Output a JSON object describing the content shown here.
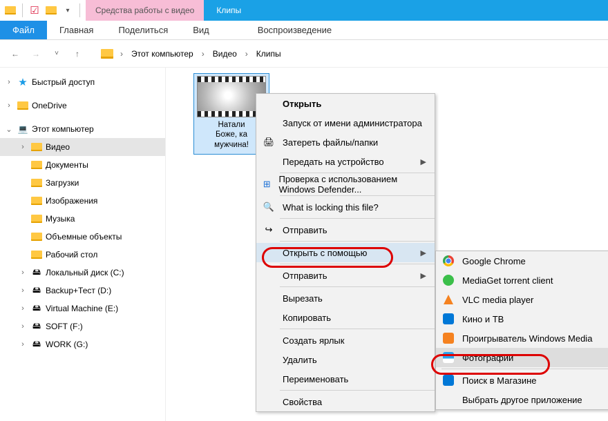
{
  "title_context_tab": "Средства работы с видео",
  "window_title": "Клипы",
  "ribbon": {
    "file": "Файл",
    "home": "Главная",
    "share": "Поделиться",
    "view": "Вид",
    "playback": "Воспроизведение"
  },
  "breadcrumb": {
    "root": "Этот компьютер",
    "p1": "Видео",
    "p2": "Клипы"
  },
  "tree": {
    "quick_access": "Быстрый доступ",
    "onedrive": "OneDrive",
    "this_pc": "Этот компьютер",
    "videos": "Видео",
    "documents": "Документы",
    "downloads": "Загрузки",
    "pictures": "Изображения",
    "music": "Музыка",
    "objects3d": "Объемные объекты",
    "desktop": "Рабочий стол",
    "drive_c": "Локальный диск (C:)",
    "drive_d": "Backup+Тест (D:)",
    "drive_e": "Virtual Machine (E:)",
    "drive_f": "SOFT (F:)",
    "drive_g": "WORK (G:)"
  },
  "file": {
    "line1": "Натали",
    "line2": "Боже, ка",
    "line3": "мужчина!"
  },
  "ctx": {
    "open": "Открыть",
    "run_as_admin": "Запуск от имени администратора",
    "erase": "Затереть файлы/папки",
    "cast": "Передать на устройство",
    "defender": "Проверка с использованием Windows Defender...",
    "locking": "What is locking this file?",
    "send_to": "Отправить",
    "open_with": "Открыть с помощью",
    "send": "Отправить",
    "cut": "Вырезать",
    "copy": "Копировать",
    "shortcut": "Создать ярлык",
    "delete": "Удалить",
    "rename": "Переименовать",
    "properties": "Свойства"
  },
  "openwith": {
    "chrome": "Google Chrome",
    "mediaget": "MediaGet torrent client",
    "vlc": "VLC media player",
    "movies_tv": "Кино и ТВ",
    "wmp": "Проигрыватель Windows Media",
    "photos": "Фотографии",
    "store": "Поиск в Магазине",
    "another": "Выбрать другое приложение"
  }
}
